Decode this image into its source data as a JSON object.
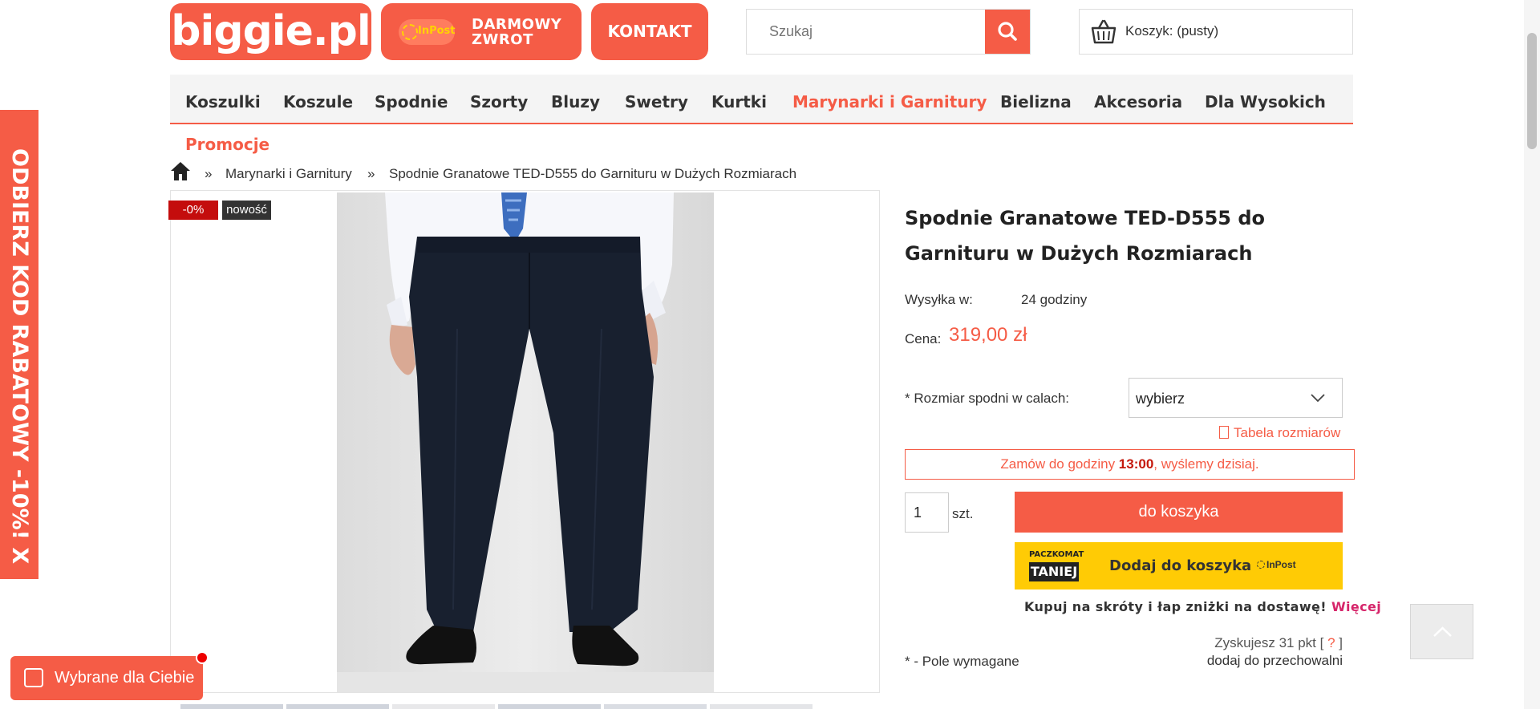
{
  "header": {
    "logo": "biggie.pl",
    "inpost_logo": "InPost",
    "inpost_line1": "DARMOWY",
    "inpost_line2": "ZWROT",
    "kontakt": "KONTAKT",
    "search_placeholder": "Szukaj",
    "cart_label": "Koszyk: (pusty)"
  },
  "nav": {
    "items": [
      "Koszulki",
      "Koszule",
      "Spodnie",
      "Szorty",
      "Bluzy",
      "Swetry",
      "Kurtki",
      "Marynarki i Garnitury",
      "Bielizna",
      "Akcesoria",
      "Dla Wysokich"
    ],
    "active_index": 7,
    "promo": "Promocje"
  },
  "breadcrumb": {
    "sep": "»",
    "category": "Marynarki i Garnitury",
    "current": "Spodnie Granatowe TED-D555 do Garnituru w Dużych Rozmiarach"
  },
  "badges": {
    "sale": "-0%",
    "new": "nowość"
  },
  "product": {
    "title": "Spodnie Granatowe TED-D555 do Garnituru w Dużych Rozmiarach",
    "shipping_label": "Wysyłka w:",
    "shipping_value": "24 godziny",
    "price_label": "Cena:",
    "price": "319,00 zł",
    "size_label": "* Rozmiar spodni w calach:",
    "size_value": "wybierz",
    "size_table": "Tabela rozmiarów",
    "order_pre": "Zamów do godziny ",
    "order_time": "13:00",
    "order_post": ", wyślemy dzisiaj.",
    "qty": "1",
    "qty_unit": "szt.",
    "add_to_cart": "do koszyka",
    "paczkomat_top": "PACZKOMAT",
    "paczkomat_tag": "TANIEJ",
    "paczkomat_btn": "Dodaj do koszyka",
    "paczkomat_brand": "InPost",
    "shortcut_text": "Kupuj na skróty i łap zniżki na dostawę! ",
    "shortcut_link": "Więcej",
    "points_pre": "Zyskujesz 31 pkt [ ",
    "points_q": "?",
    "points_post": " ]",
    "store_link": "dodaj do przechowalni",
    "required": "* - Pole wymagane"
  },
  "side_banner": "ODBIERZ KOD RABATOWY -10%!  X",
  "floating": {
    "wybrane": "Wybrane dla Ciebie"
  },
  "colors": {
    "accent": "#f55c46",
    "sale_badge": "#c40d0d",
    "paczkomat": "#ffcb05"
  }
}
